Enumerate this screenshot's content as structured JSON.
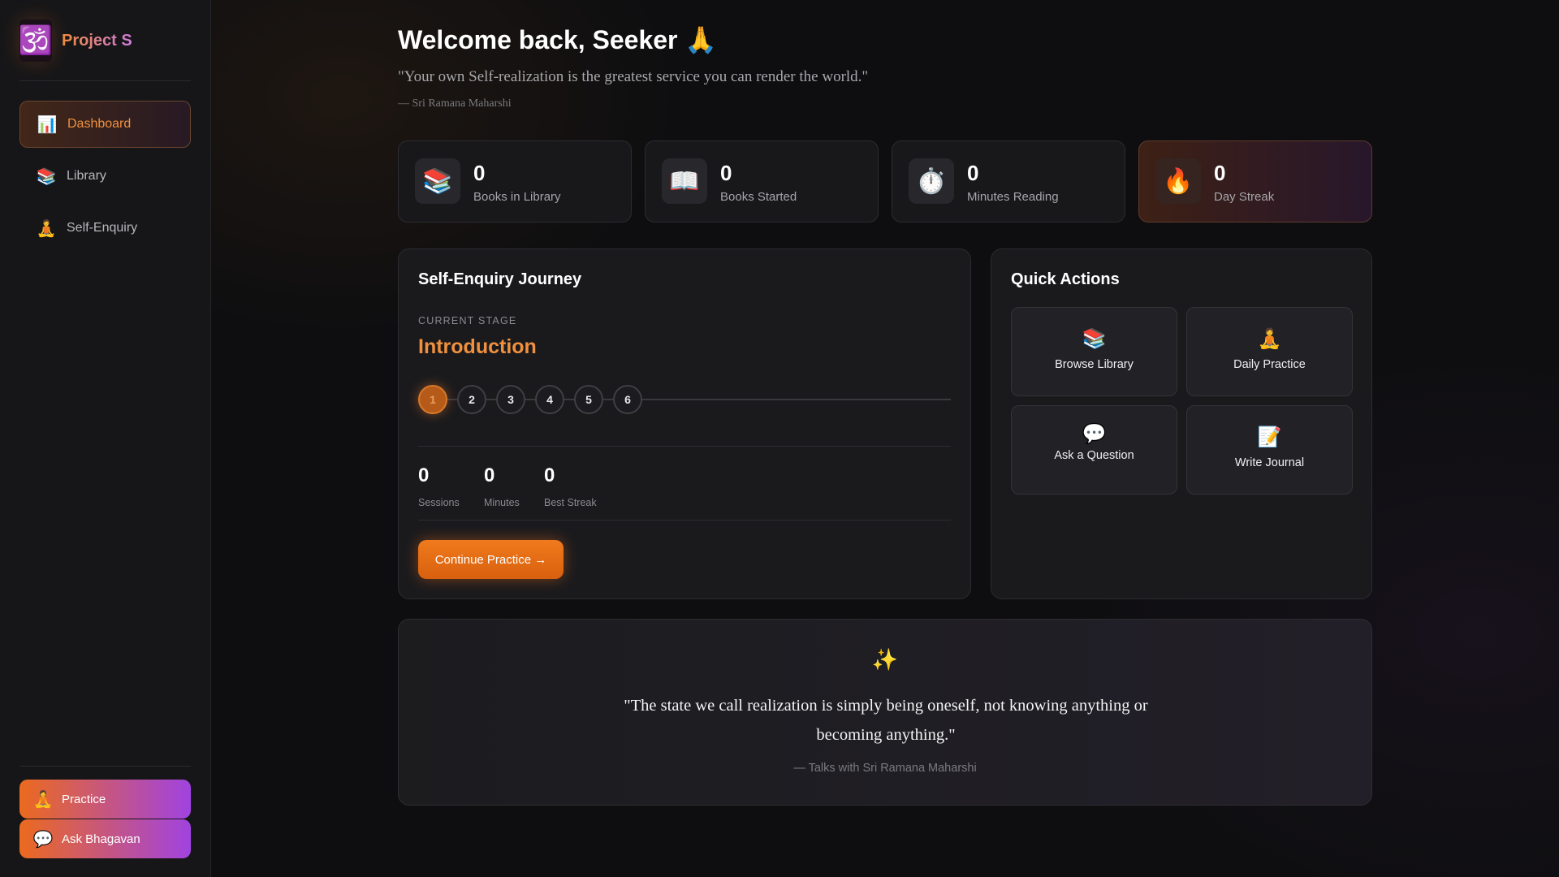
{
  "sidebar": {
    "brand": {
      "logo_glyph": "🕉️",
      "name": "Project S"
    },
    "nav": [
      {
        "icon": "📊",
        "icon_name": "bar-chart-icon",
        "label": "Dashboard",
        "active": true
      },
      {
        "icon": "📚",
        "icon_name": "books-icon",
        "label": "Library",
        "active": false
      },
      {
        "icon": "🧘",
        "icon_name": "meditation-icon",
        "label": "Self-Enquiry",
        "active": false
      }
    ],
    "bottom_buttons": [
      {
        "icon": "🧘",
        "icon_name": "meditation-icon",
        "label": "Practice"
      },
      {
        "icon": "💬",
        "icon_name": "speech-bubble-icon",
        "label": "Ask Bhagavan"
      }
    ]
  },
  "header": {
    "welcome": "Welcome back, Seeker 🙏",
    "quote": "\"Your own Self-realization is the greatest service you can render the world.\"",
    "quote_author": "— Sri Ramana Maharshi"
  },
  "stats": [
    {
      "icon": "📚",
      "icon_name": "books-icon",
      "value": "0",
      "label": "Books in Library"
    },
    {
      "icon": "📖",
      "icon_name": "open-book-icon",
      "value": "0",
      "label": "Books Started"
    },
    {
      "icon": "⏱️",
      "icon_name": "stopwatch-icon",
      "value": "0",
      "label": "Minutes Reading"
    },
    {
      "icon": "🔥",
      "icon_name": "fire-icon",
      "value": "0",
      "label": "Day Streak"
    }
  ],
  "journey": {
    "title": "Self-Enquiry Journey",
    "stage_caption": "CURRENT STAGE",
    "stage_name": "Introduction",
    "steps": [
      "1",
      "2",
      "3",
      "4",
      "5",
      "6"
    ],
    "current_step": 1,
    "metrics": [
      {
        "value": "0",
        "label": "Sessions"
      },
      {
        "value": "0",
        "label": "Minutes"
      },
      {
        "value": "0",
        "label": "Best Streak"
      }
    ],
    "continue_label": "Continue Practice →"
  },
  "quick_actions": {
    "title": "Quick Actions",
    "items": [
      {
        "icon": "📚",
        "icon_name": "books-icon",
        "label": "Browse Library"
      },
      {
        "icon": "🧘",
        "icon_name": "meditation-icon",
        "label": "Daily Practice"
      },
      {
        "icon": "💬",
        "icon_name": "speech-bubble-icon",
        "label": "Ask a Question"
      },
      {
        "icon": "📝",
        "icon_name": "memo-icon",
        "label": "Write Journal"
      }
    ]
  },
  "bottom_quote": {
    "icon": "✨",
    "text": "\"The state we call realization is simply being oneself, not knowing anything or becoming anything.\"",
    "author": "— Talks with Sri Ramana Maharshi"
  },
  "colors": {
    "accent_orange": "#f0903e",
    "accent_purple": "#a043e0",
    "background": "#0e0e10",
    "card": "#18181b"
  }
}
